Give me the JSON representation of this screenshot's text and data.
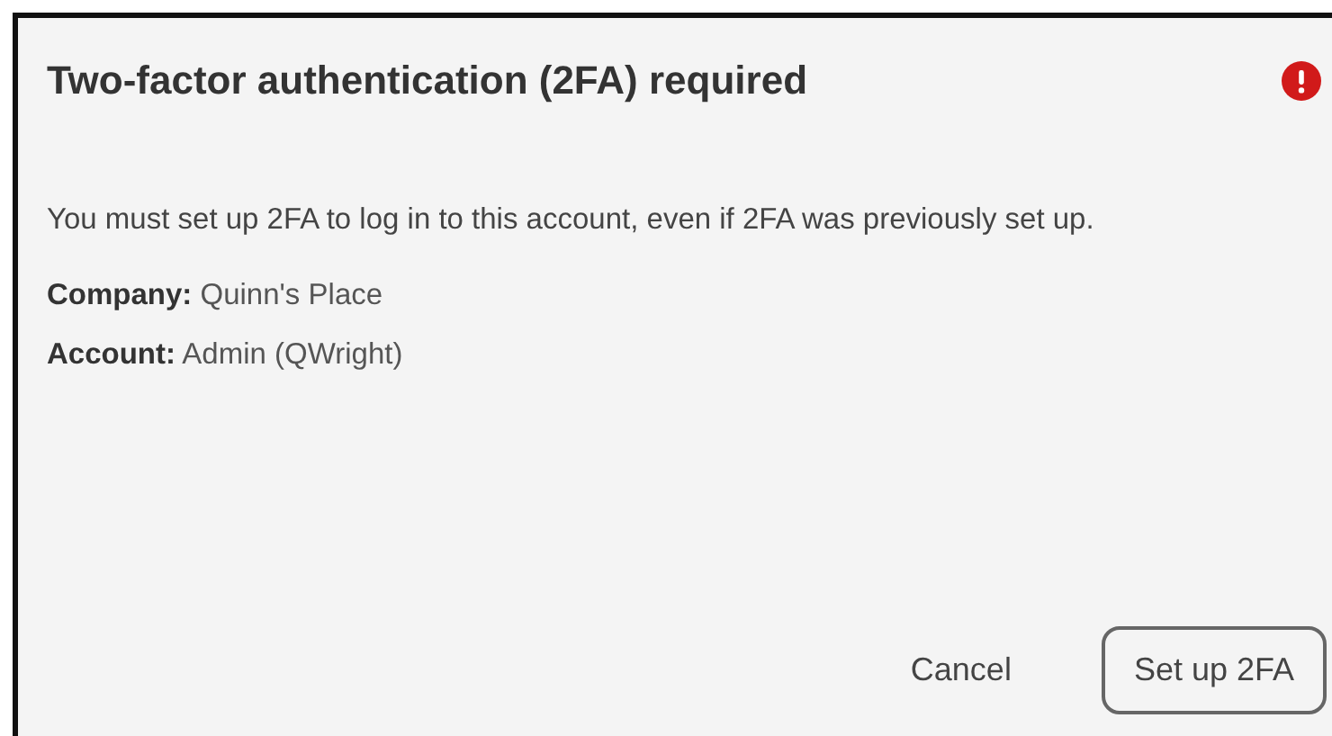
{
  "dialog": {
    "title": "Two-factor authentication (2FA) required",
    "message": "You must set up 2FA to log in to this account, even if 2FA was previously set up.",
    "details": [
      "**Company:** Quinn's Place",
      "**Account:** Admin (QWright)"
    ],
    "buttons": [
      {
        "label": "Cancel",
        "kind": "text"
      },
      {
        "label": "Set up 2FA",
        "kind": "outlined"
      }
    ]
  }
}
